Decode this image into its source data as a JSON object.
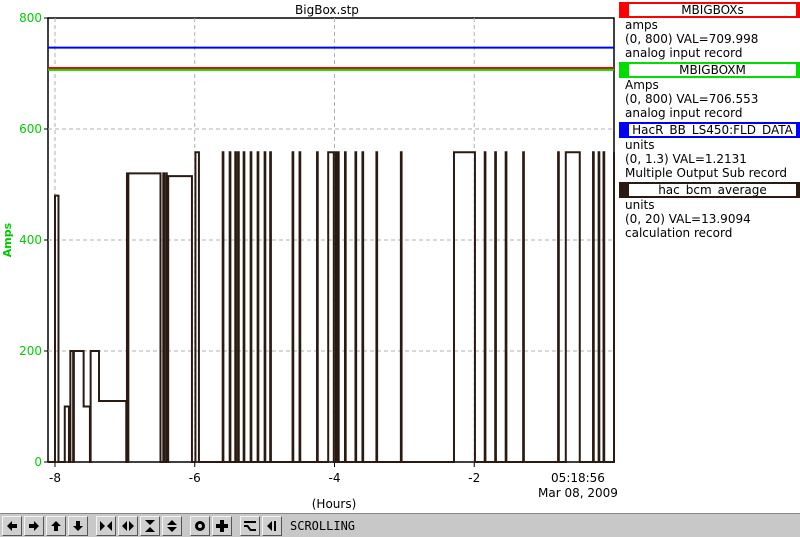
{
  "chart_data": {
    "type": "line",
    "title": "BigBox.stp",
    "xlabel": "(Hours)",
    "ylabel": "Amps",
    "xlim": [
      -8.1,
      0.0
    ],
    "ylim": [
      0,
      800
    ],
    "x_ticks": [
      -8,
      -6,
      -4,
      -2
    ],
    "x_tick_labels": [
      "-8",
      "-6",
      "-4",
      "-2"
    ],
    "y_ticks": [
      0,
      200,
      400,
      600,
      800
    ],
    "y_tick_labels": [
      "0",
      "200",
      "400",
      "600",
      "800"
    ],
    "time_label": "05:18:56",
    "date_label": "Mar 08, 2009",
    "grid": true,
    "series": [
      {
        "name": "MBIGBOXs",
        "color": "#ff0000",
        "constant": 709.998,
        "range": [
          0,
          800
        ]
      },
      {
        "name": "MBIGBOXM",
        "color": "#00dd00",
        "constant": 706.553,
        "range": [
          0,
          800
        ]
      },
      {
        "name": "HacR_BB_LS450:FLD_DATA",
        "color": "#0000ff",
        "constant": 1.2131,
        "range": [
          0,
          1.3
        ]
      },
      {
        "name": "hac_bcm_average",
        "color": "#2a1a12",
        "range": [
          0,
          20
        ],
        "x": [
          -8.1,
          -8.0,
          -7.98,
          -7.95,
          -7.87,
          -7.86,
          -7.8,
          -7.79,
          -7.78,
          -7.77,
          -7.74,
          -7.73,
          -7.6,
          -7.59,
          -7.5,
          -7.49,
          -7.38,
          -7.37,
          -7.0,
          -6.98,
          -6.97,
          -6.96,
          -6.95,
          -6.94,
          -6.5,
          -6.49,
          -6.45,
          -6.44,
          -6.41,
          -6.4,
          -6.38,
          -6.37,
          -6.05,
          -6.04,
          -6.0,
          -5.99,
          -5.95,
          -5.94,
          -5.6,
          -5.59,
          -5.5,
          -5.49,
          -5.42,
          -5.41,
          -5.38,
          -5.37,
          -5.3,
          -5.29,
          -5.2,
          -5.19,
          -5.1,
          -5.09,
          -5.0,
          -4.99,
          -4.92,
          -4.91,
          -4.6,
          -4.59,
          -4.5,
          -4.49,
          -4.25,
          -4.24,
          -4.1,
          -4.09,
          -4.02,
          -4.01,
          -3.98,
          -3.97,
          -3.95,
          -3.94,
          -3.85,
          -3.84,
          -3.7,
          -3.69,
          -3.6,
          -3.59,
          -3.4,
          -3.39,
          -3.05,
          -3.04,
          -2.3,
          -2.29,
          -2.0,
          -1.99,
          -1.85,
          -1.84,
          -1.7,
          -1.69,
          -1.55,
          -1.54,
          -1.3,
          -1.29,
          -0.8,
          -0.79,
          -0.7,
          -0.69,
          -0.5,
          -0.49,
          -0.3,
          -0.29,
          -0.22,
          -0.21,
          -0.15,
          -0.14,
          0.0
        ],
        "values_amps": [
          0,
          480,
          480,
          0,
          0,
          100,
          0,
          0,
          200,
          200,
          0,
          200,
          200,
          100,
          0,
          200,
          200,
          110,
          110,
          0,
          520,
          0,
          520,
          520,
          520,
          0,
          520,
          0,
          520,
          0,
          515,
          515,
          515,
          0,
          0,
          558,
          558,
          0,
          558,
          0,
          558,
          0,
          558,
          0,
          558,
          0,
          558,
          0,
          558,
          0,
          558,
          0,
          558,
          0,
          558,
          0,
          558,
          0,
          558,
          0,
          558,
          0,
          0,
          558,
          558,
          0,
          558,
          0,
          558,
          0,
          558,
          0,
          558,
          0,
          558,
          0,
          558,
          0,
          558,
          0,
          0,
          558,
          558,
          0,
          558,
          0,
          558,
          0,
          558,
          0,
          558,
          0,
          558,
          0,
          0,
          558,
          558,
          0,
          558,
          0,
          558,
          0,
          558,
          0,
          558
        ]
      }
    ]
  },
  "legend": [
    {
      "name": "MBIGBOXs",
      "units": "amps",
      "range_text": "(0, 800) VAL=709.998",
      "record_type": "analog input record",
      "color": "#ff0000"
    },
    {
      "name": "MBIGBOXM",
      "units": "Amps",
      "range_text": "(0, 800) VAL=706.553",
      "record_type": "analog input record",
      "color": "#00dd00"
    },
    {
      "name": "HacR_BB_LS450:FLD_DATA",
      "units": "units",
      "range_text": "(0, 1.3) VAL=1.2131",
      "record_type": "Multiple Output Sub record",
      "color": "#0000ff"
    },
    {
      "name": "hac_bcm_average",
      "units": "units",
      "range_text": "(0, 20) VAL=13.9094",
      "record_type": "calculation record",
      "color": "#2a1a12"
    }
  ],
  "toolbar": {
    "buttons": [
      "arrow-left-icon",
      "arrow-right-icon",
      "arrow-up-icon",
      "arrow-down-icon",
      "zoom-in-x-icon",
      "zoom-out-x-icon",
      "zoom-in-y-icon",
      "zoom-out-y-icon",
      "center-icon",
      "add-icon",
      "autoscale-icon",
      "scroll-icon"
    ],
    "status": "SCROLLING"
  }
}
